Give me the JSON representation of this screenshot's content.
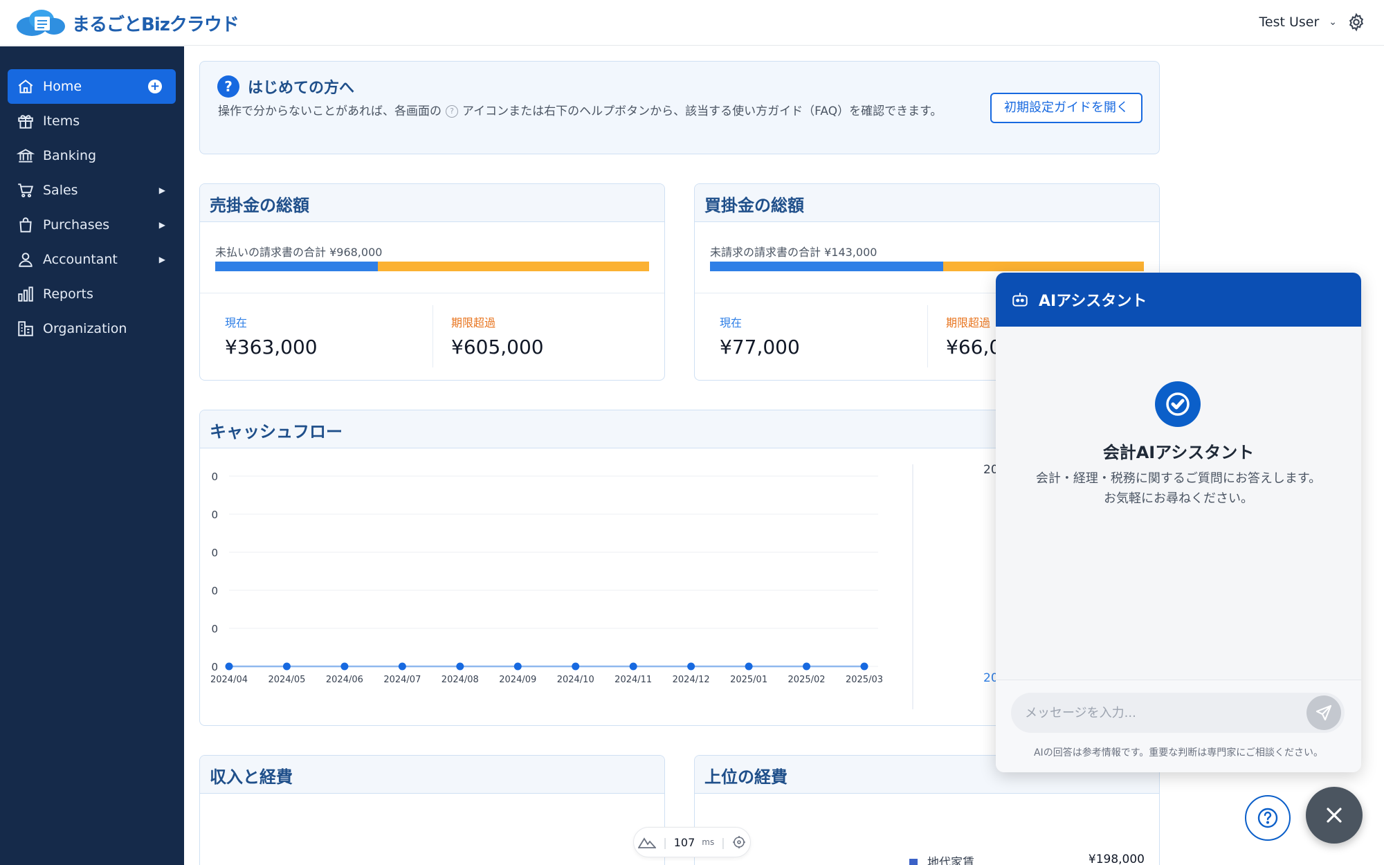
{
  "app": {
    "name": "まるごとBizクラウド",
    "user": "Test User"
  },
  "sidebar": {
    "items": [
      {
        "label": "Home"
      },
      {
        "label": "Items"
      },
      {
        "label": "Banking"
      },
      {
        "label": "Sales"
      },
      {
        "label": "Purchases"
      },
      {
        "label": "Accountant"
      },
      {
        "label": "Reports"
      },
      {
        "label": "Organization"
      }
    ]
  },
  "welcome": {
    "title": "はじめての方へ",
    "message_pre": "操作で分からないことがあれば、各画面の",
    "message_post": "アイコンまたは右下のヘルプボタンから、該当する使い方ガイド（FAQ）を確認できます。",
    "guide_button": "初期設定ガイドを開く"
  },
  "receivables": {
    "title": "売掛金の総額",
    "bar_label": "未払いの請求書の合計 ¥968,000",
    "current_label": "現在",
    "current_value": "¥363,000",
    "overdue_label": "期限超過",
    "overdue_value": "¥605,000",
    "current_fraction": 0.375
  },
  "payables": {
    "title": "買掛金の総額",
    "bar_label": "未請求の請求書の合計 ¥143,000",
    "current_label": "現在",
    "current_value": "¥77,000",
    "overdue_label": "期限超過",
    "overdue_value": "¥66,0",
    "current_fraction": 0.538
  },
  "cashflow": {
    "title": "キャッシュフロー",
    "right_label_top": "20",
    "right_label_bottom": "20"
  },
  "chart_data": {
    "type": "line",
    "title": "",
    "x": [
      "2024/04",
      "2024/05",
      "2024/06",
      "2024/07",
      "2024/08",
      "2024/09",
      "2024/10",
      "2024/11",
      "2024/12",
      "2025/01",
      "2025/02",
      "2025/03"
    ],
    "series": [
      {
        "values": [
          0,
          0,
          0,
          0,
          0,
          0,
          0,
          0,
          0,
          0,
          0,
          0
        ]
      }
    ],
    "y_tick_labels": [
      "0",
      "0",
      "0",
      "0",
      "0",
      "0"
    ],
    "grid": true,
    "colors": {
      "line": "#8fb8ee",
      "point": "#1769e0"
    }
  },
  "income_expense": {
    "title": "収入と経費"
  },
  "top_expenses": {
    "title": "上位の経費",
    "items": [
      {
        "label": "地代家賃",
        "amount": "¥198,000"
      }
    ]
  },
  "perf": {
    "value": "107",
    "unit": "ms"
  },
  "ai": {
    "header": "AIアシスタント",
    "title": "会計AIアシスタント",
    "description": "会計・経理・税務に関するご質問にお答えします。お気軽にお尋ねください。",
    "placeholder": "メッセージを入力...",
    "note": "AIの回答は参考情報です。重要な判断は専門家にご相談ください。"
  },
  "colors": {
    "primary": "#1769e0",
    "sidebar": "#152a4a",
    "current": "#2f7fe6",
    "overdue": "#fbb132",
    "ai_header": "#0b4fb4"
  }
}
